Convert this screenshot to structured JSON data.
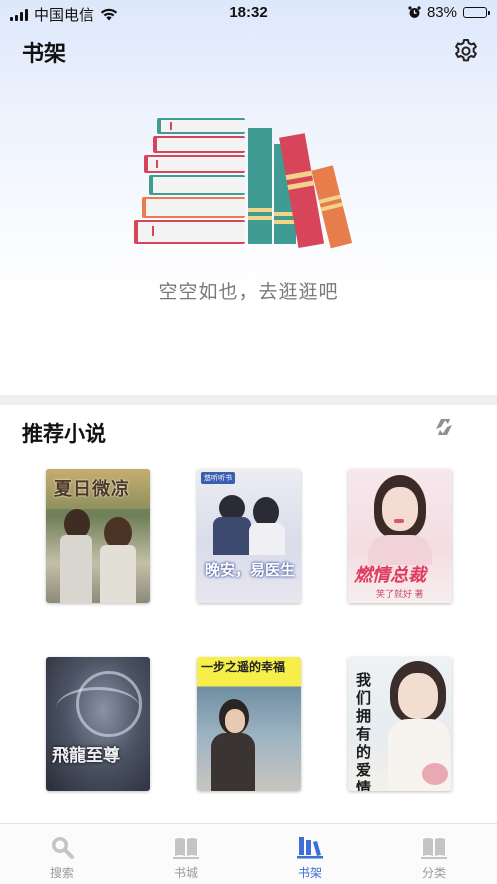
{
  "status_bar": {
    "carrier": "中国电信",
    "time": "18:32",
    "battery_percent": "83%",
    "battery_level": 0.83
  },
  "header": {
    "title": "书架",
    "settings_icon": "gear-icon"
  },
  "shelf": {
    "empty_message": "空空如也，去逛逛吧"
  },
  "recommend": {
    "title": "推荐小说",
    "refresh_icon": "refresh-icon",
    "books": [
      {
        "cover_title": "夏日微凉"
      },
      {
        "cover_title": "晚安，易医生",
        "publisher_badge": "悠听听书"
      },
      {
        "cover_title": "燃情总裁",
        "author_line": "笑了就好 著"
      },
      {
        "cover_title": "飛龍至尊"
      },
      {
        "cover_title": "一步之遥的幸福"
      },
      {
        "cover_title": "我们拥有的爱情"
      }
    ]
  },
  "tabs": [
    {
      "label": "搜索",
      "icon": "search-icon"
    },
    {
      "label": "书城",
      "icon": "book-open-icon"
    },
    {
      "label": "书架",
      "icon": "bookshelf-icon",
      "active": true
    },
    {
      "label": "分类",
      "icon": "category-icon"
    }
  ],
  "colors": {
    "accent": "#3d6fd6",
    "tab_inactive": "#9a9a9a"
  }
}
